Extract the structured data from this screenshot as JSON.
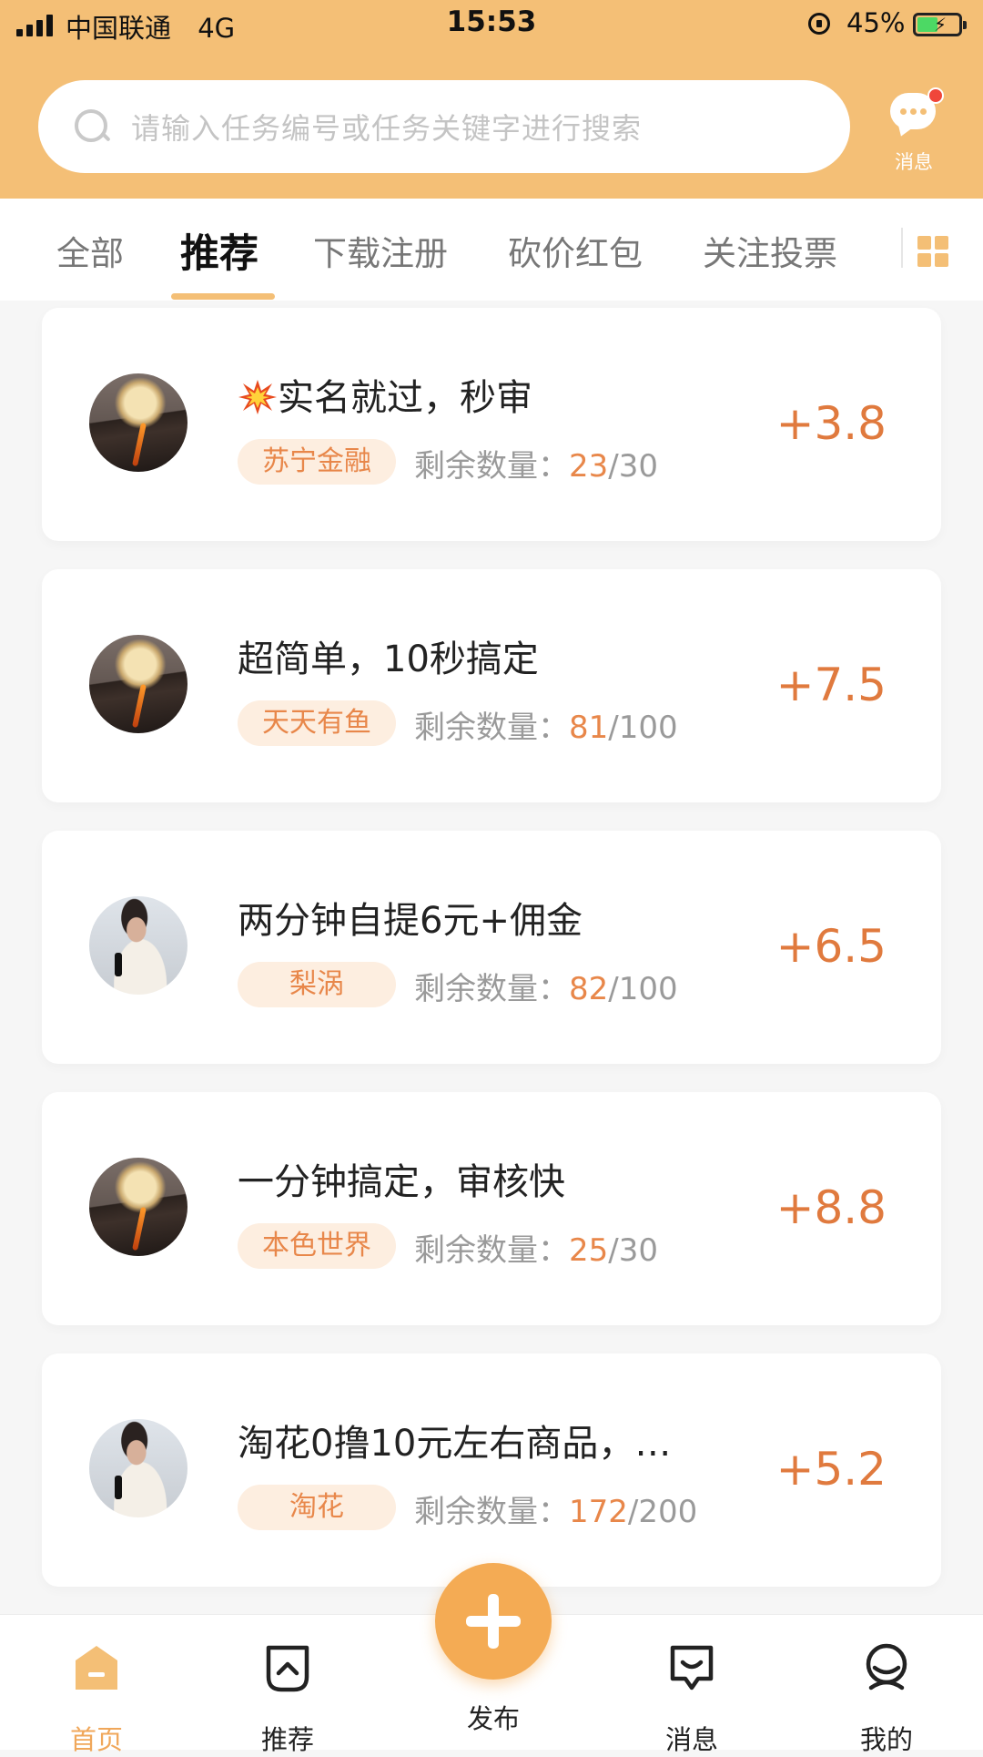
{
  "status_bar": {
    "carrier": "中国联通",
    "network": "4G",
    "time": "15:53",
    "battery": "45%"
  },
  "search": {
    "placeholder": "请输入任务编号或任务关键字进行搜索"
  },
  "header": {
    "message_label": "消息"
  },
  "tabs": [
    {
      "label": "全部",
      "active": false
    },
    {
      "label": "推荐",
      "active": true
    },
    {
      "label": "下载注册",
      "active": false
    },
    {
      "label": "砍价红包",
      "active": false
    },
    {
      "label": "关注投票",
      "active": false
    }
  ],
  "tasks": [
    {
      "title": "实名就过，秒审",
      "title_icon": "burst-icon",
      "source": "苏宁金融",
      "remain_label": "剩余数量：",
      "remain_done": "23",
      "remain_total": "/30",
      "reward": "+3.8",
      "avatar": "moon"
    },
    {
      "title": "超简单，10秒搞定",
      "source": "天天有鱼",
      "remain_label": "剩余数量：",
      "remain_done": "81",
      "remain_total": "/100",
      "reward": "+7.5",
      "avatar": "moon"
    },
    {
      "title": "两分钟自提6元+佣金",
      "source": "梨涡",
      "remain_label": "剩余数量：",
      "remain_done": "82",
      "remain_total": "/100",
      "reward": "+6.5",
      "avatar": "person"
    },
    {
      "title": "一分钟搞定，审核快",
      "source": "本色世界",
      "remain_label": "剩余数量：",
      "remain_done": "25",
      "remain_total": "/30",
      "reward": "+8.8",
      "avatar": "moon"
    },
    {
      "title": "淘花0撸10元左右商品，…",
      "source": "淘花",
      "remain_label": "剩余数量：",
      "remain_done": "172",
      "remain_total": "/200",
      "reward": "+5.2",
      "avatar": "person"
    }
  ],
  "bottom_nav": [
    {
      "label": "首页",
      "icon": "home-icon",
      "active": true
    },
    {
      "label": "推荐",
      "icon": "recommend-icon",
      "active": false
    },
    {
      "label": "发布",
      "icon": "plus-icon",
      "active": false
    },
    {
      "label": "消息",
      "icon": "message-icon",
      "active": false
    },
    {
      "label": "我的",
      "icon": "profile-icon",
      "active": false
    }
  ],
  "colors": {
    "brand": "#f4bf76",
    "accent": "#e8874a",
    "reward": "#e07a3e"
  }
}
